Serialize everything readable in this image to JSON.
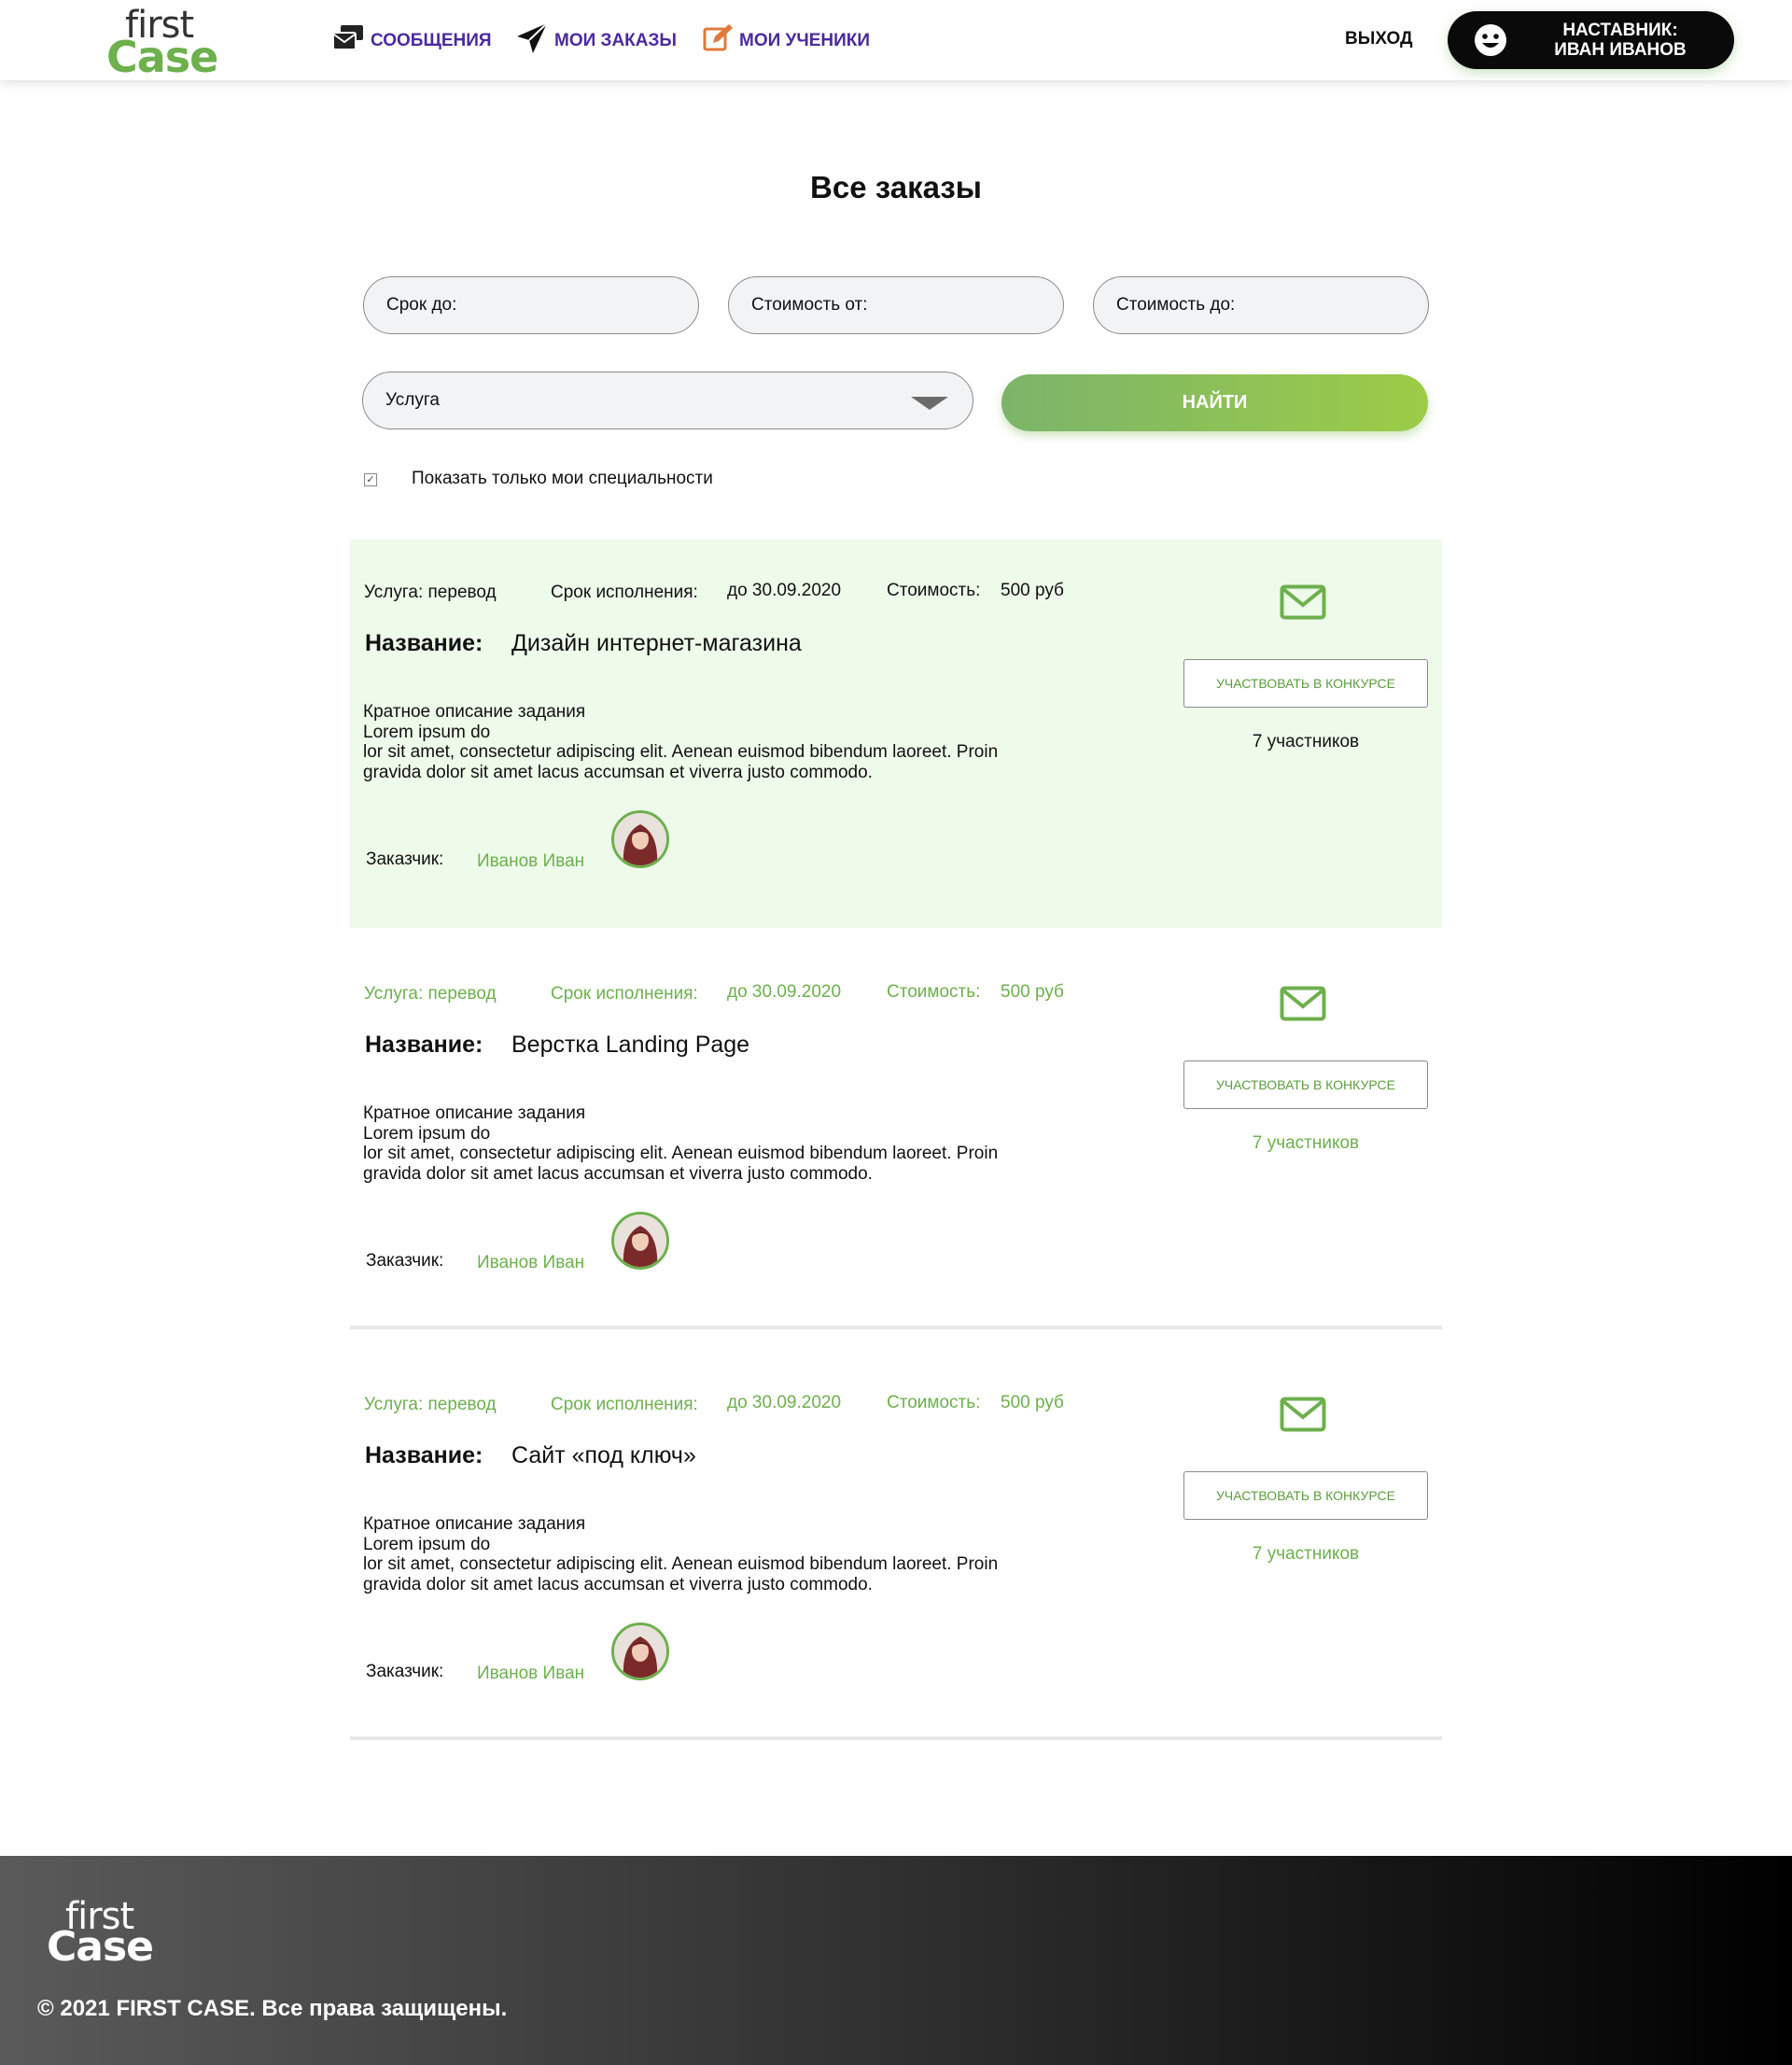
{
  "header": {
    "logo_top": "first",
    "logo_bottom": "Case",
    "nav": [
      {
        "label": "СООБЩЕНИЯ",
        "icon": "messages-icon"
      },
      {
        "label": "МОИ ЗАКАЗЫ",
        "icon": "paper-plane-icon"
      },
      {
        "label": "МОИ УЧЕНИКИ",
        "icon": "edit-icon"
      }
    ],
    "logout_label": "ВЫХОД",
    "mentor_line1": "НАСТАВНИК:",
    "mentor_line2": "ИВАН ИВАНОВ"
  },
  "page_title": "Все заказы",
  "filters": {
    "deadline_placeholder": "Срок до:",
    "price_from_placeholder": "Стоимость от:",
    "price_to_placeholder": "Стоимость до:",
    "service_label": "Услуга",
    "find_label": "НАЙТИ",
    "only_mine_label": "Показать только мои специальности",
    "only_mine_checked": true
  },
  "orders": [
    {
      "service": "Услуга: перевод",
      "deadline_label": "Срок исполнения:",
      "deadline_value": "до 30.09.2020",
      "price_label": "Стоимость:",
      "price_value": "500 руб",
      "name_label": "Название:",
      "name_value": "Дизайн интернет-магазина",
      "description": [
        "Кратное описание задания",
        "Lorem ipsum do",
        "lor sit amet, consectetur adipiscing elit. Aenean euismod bibendum laoreet. Proin",
        "gravida dolor sit amet lacus accumsan et viverra justo commodo."
      ],
      "customer_label": "Заказчик:",
      "customer_name": "Иванов Иван",
      "join_label": "УЧАСТВОВАТЬ В КОНКУРСЕ",
      "participants": "7 участников",
      "highlighted": true
    },
    {
      "service": "Услуга: перевод",
      "deadline_label": "Срок исполнения:",
      "deadline_value": "до 30.09.2020",
      "price_label": "Стоимость:",
      "price_value": "500 руб",
      "name_label": "Название:",
      "name_value": "Верстка Landing Page",
      "description": [
        "Кратное описание задания",
        "Lorem ipsum do",
        "lor sit amet, consectetur adipiscing elit. Aenean euismod bibendum laoreet. Proin",
        "gravida dolor sit amet lacus accumsan et viverra justo commodo."
      ],
      "customer_label": "Заказчик:",
      "customer_name": "Иванов Иван",
      "join_label": "УЧАСТВОВАТЬ В КОНКУРСЕ",
      "participants": "7 участников",
      "highlighted": false
    },
    {
      "service": "Услуга: перевод",
      "deadline_label": "Срок исполнения:",
      "deadline_value": "до 30.09.2020",
      "price_label": "Стоимость:",
      "price_value": "500 руб",
      "name_label": "Название:",
      "name_value": "Сайт «под ключ»",
      "description": [
        "Кратное описание задания",
        "Lorem ipsum do",
        "lor sit amet, consectetur adipiscing elit. Aenean euismod bibendum laoreet. Proin",
        "gravida dolor sit amet lacus accumsan et viverra justo commodo."
      ],
      "customer_label": "Заказчик:",
      "customer_name": "Иванов Иван",
      "join_label": "УЧАСТВОВАТЬ В КОНКУРСЕ",
      "participants": "7 участников",
      "highlighted": false
    }
  ],
  "footer": {
    "logo_top": "first",
    "logo_bottom": "Case",
    "copyright": "© 2021 FIRST CASE. Все права защищены."
  },
  "colors": {
    "brand_green": "#6db04d",
    "nav_purple": "#4b2aa0",
    "highlight_bg": "#eefaea"
  }
}
